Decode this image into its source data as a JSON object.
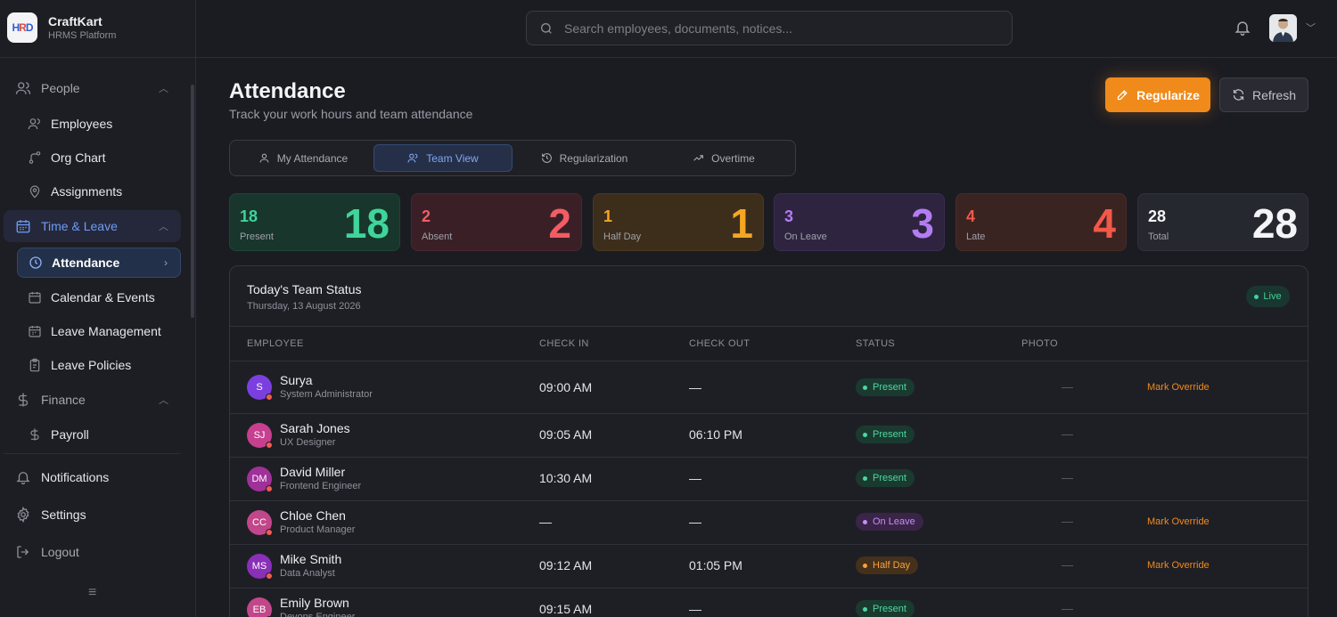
{
  "brand": {
    "name": "CraftKart",
    "subtitle": "HRMS Platform",
    "logo_text": "HRD"
  },
  "search": {
    "placeholder": "Search employees, documents, notices..."
  },
  "sidebar": {
    "people": {
      "label": "People",
      "items": [
        "Employees",
        "Org Chart",
        "Assignments"
      ]
    },
    "time_leave": {
      "label": "Time & Leave",
      "items": [
        "Attendance",
        "Calendar & Events",
        "Leave Management",
        "Leave Policies"
      ]
    },
    "finance": {
      "label": "Finance",
      "items": [
        "Payroll"
      ]
    },
    "footer": [
      "Notifications",
      "Settings",
      "Logout"
    ]
  },
  "page": {
    "title": "Attendance",
    "subtitle": "Track your work hours and team attendance",
    "regularize_label": "Regularize",
    "refresh_label": "Refresh"
  },
  "tabs": [
    "My Attendance",
    "Team View",
    "Regularization",
    "Overtime"
  ],
  "active_tab": "Team View",
  "stats": [
    {
      "value": "18",
      "label": "Present",
      "color": "#3fd49a"
    },
    {
      "value": "2",
      "label": "Absent",
      "color": "#f25c64"
    },
    {
      "value": "1",
      "label": "Half Day",
      "color": "#f5a623"
    },
    {
      "value": "3",
      "label": "On Leave",
      "color": "#b37df2"
    },
    {
      "value": "4",
      "label": "Late",
      "color": "#f2584a"
    },
    {
      "value": "28",
      "label": "Total",
      "color": "#f4f4f6"
    }
  ],
  "table": {
    "title": "Today's Team Status",
    "date": "Thursday, 13 August 2026",
    "live_label": "Live",
    "columns": [
      "EMPLOYEE",
      "CHECK IN",
      "CHECK OUT",
      "STATUS",
      "PHOTO"
    ],
    "rows": [
      {
        "initials": "S",
        "name": "Surya",
        "role": "System Administrator",
        "check_in": "09:00 AM",
        "check_out": "—",
        "status": "Present",
        "photo": "—",
        "action": "Mark Override"
      },
      {
        "initials": "SJ",
        "name": "Sarah Jones",
        "role": "UX Designer",
        "check_in": "09:05 AM",
        "check_out": "06:10 PM",
        "status": "Present",
        "photo": "—",
        "action": ""
      },
      {
        "initials": "DM",
        "name": "David Miller",
        "role": "Frontend Engineer",
        "check_in": "10:30 AM",
        "check_out": "—",
        "status": "Present",
        "photo": "—",
        "action": ""
      },
      {
        "initials": "CC",
        "name": "Chloe Chen",
        "role": "Product Manager",
        "check_in": "—",
        "check_out": "—",
        "status": "On Leave",
        "photo": "—",
        "action": "Mark Override"
      },
      {
        "initials": "MS",
        "name": "Mike Smith",
        "role": "Data Analyst",
        "check_in": "09:12 AM",
        "check_out": "01:05 PM",
        "status": "Half Day",
        "photo": "—",
        "action": "Mark Override"
      },
      {
        "initials": "EB",
        "name": "Emily Brown",
        "role": "Devops Engineer",
        "check_in": "09:15 AM",
        "check_out": "—",
        "status": "Present",
        "photo": "—",
        "action": ""
      }
    ]
  },
  "colors": {
    "accent": "#f08a1b",
    "primary": "#6e9cf7"
  }
}
